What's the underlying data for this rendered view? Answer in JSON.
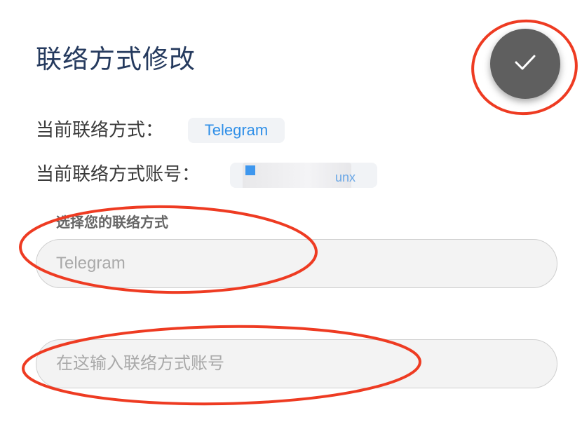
{
  "header": {
    "title": "联络方式修改",
    "confirm_icon": "check-icon"
  },
  "current": {
    "type_label": "当前联络方式：",
    "type_value": "Telegram",
    "account_label": "当前联络方式账号：",
    "account_value_visible_tail": "unx"
  },
  "form": {
    "type_field_label": "选择您的联络方式",
    "type_field_placeholder": "Telegram",
    "account_field_placeholder": "在这输入联络方式账号"
  },
  "colors": {
    "title": "#253a5e",
    "accent": "#2f8fe8",
    "confirm_button": "#5f5f5f",
    "annotation_red": "#ee3b22"
  }
}
